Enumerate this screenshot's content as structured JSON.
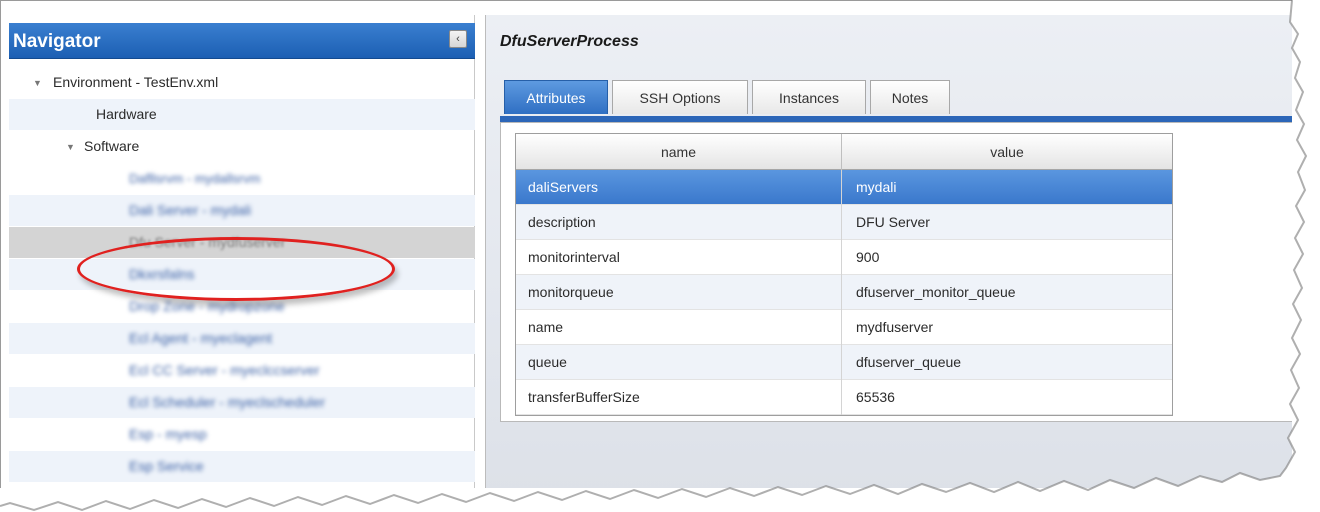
{
  "navigator": {
    "title": "Navigator",
    "collapse_glyph": "‹",
    "tree": [
      {
        "label": "Environment - TestEnv.xml",
        "indent": 1,
        "twisty": "expanded",
        "blurred": false
      },
      {
        "label": "Hardware",
        "indent": 2,
        "twisty": "none",
        "blurred": false
      },
      {
        "label": "Software",
        "indent": 2,
        "twisty": "expanded",
        "blurred": false
      },
      {
        "label": "Dali Server - mydali",
        "indent": 3,
        "twisty": "none",
        "blurred": true
      },
      {
        "label": "Dfu Server - mydfuserver",
        "indent": 3,
        "twisty": "none",
        "blurred": true,
        "selected": true
      },
      {
        "label": "Drop Zone - mydropzone",
        "indent": 3,
        "twisty": "none",
        "blurred": true
      },
      {
        "label": "Esp - myesp",
        "indent": 3,
        "twisty": "none",
        "blurred": true
      }
    ]
  },
  "panel": {
    "title": "DfuServerProcess",
    "tabs": [
      {
        "label": "Attributes",
        "active": true
      },
      {
        "label": "SSH Options",
        "active": false
      },
      {
        "label": "Instances",
        "active": false
      },
      {
        "label": "Notes",
        "active": false
      }
    ],
    "grid": {
      "columns": [
        "name",
        "value"
      ],
      "rows": [
        {
          "name": "daliServers",
          "value": "mydali",
          "selected": true
        },
        {
          "name": "description",
          "value": "DFU Server"
        },
        {
          "name": "monitorinterval",
          "value": "900"
        },
        {
          "name": "monitorqueue",
          "value": "dfuserver_monitor_queue"
        },
        {
          "name": "name",
          "value": "mydfuserver"
        },
        {
          "name": "queue",
          "value": "dfuserver_queue"
        },
        {
          "name": "transferBufferSize",
          "value": "65536"
        }
      ]
    }
  },
  "colors": {
    "accent": "#2c66b8",
    "selection": "#3a78cc",
    "highlight_oval": "#e0211f"
  }
}
